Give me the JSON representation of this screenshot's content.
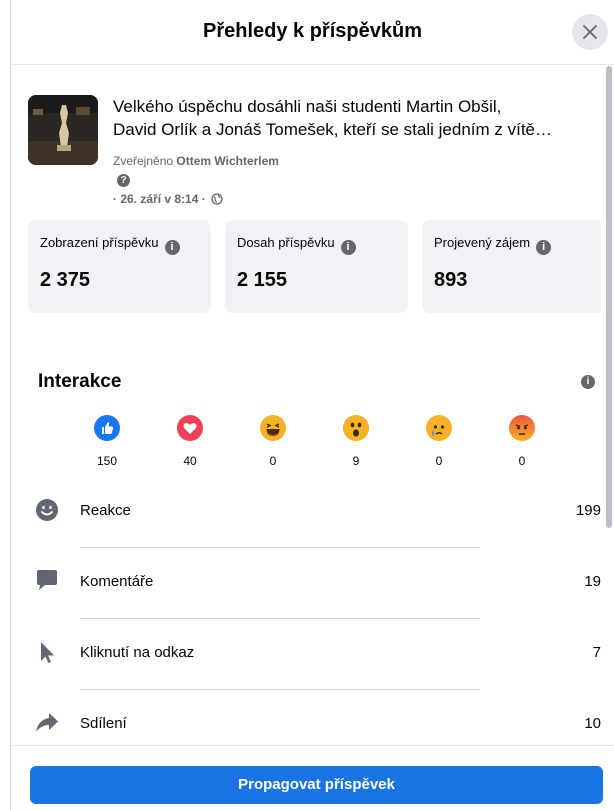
{
  "dialog": {
    "title": "Přehledy k příspěvkům",
    "close_icon": "close-icon"
  },
  "post": {
    "text": "Velkého úspěchu dosáhli naši studenti Martin Obšil,\nDavid Orlík a Jonáš Tomešek, kteří se stali jedním z vítě…",
    "published_prefix": "Zveřejněno",
    "author": "Ottem Wichterlem",
    "date": "· 26. září v 8:14 ·",
    "privacy_icon": "globe-icon"
  },
  "metrics": [
    {
      "label": "Zobrazení příspěvku",
      "value": "2 375"
    },
    {
      "label": "Dosah příspěvku",
      "value": "2 155"
    },
    {
      "label": "Projevený zájem",
      "value": "893"
    }
  ],
  "interactions": {
    "title": "Interakce",
    "reactions": [
      {
        "icon": "like-icon",
        "count": "150",
        "color": "#1877f2"
      },
      {
        "icon": "love-icon",
        "count": "40",
        "color": "#f33e58"
      },
      {
        "icon": "haha-icon",
        "count": "0",
        "color": "#f7b125"
      },
      {
        "icon": "wow-icon",
        "count": "9",
        "color": "#f7b125"
      },
      {
        "icon": "sad-icon",
        "count": "0",
        "color": "#f7b125"
      },
      {
        "icon": "angry-icon",
        "count": "0",
        "color": "#e9710f"
      }
    ],
    "rows": [
      {
        "icon": "smiley-icon",
        "label": "Reakce",
        "value": "199"
      },
      {
        "icon": "comment-icon",
        "label": "Komentáře",
        "value": "19"
      },
      {
        "icon": "cursor-icon",
        "label": "Kliknutí na odkaz",
        "value": "7"
      },
      {
        "icon": "share-icon",
        "label": "Sdílení",
        "value": "10"
      }
    ]
  },
  "footer": {
    "promote_label": "Propagovat příspěvek"
  },
  "colors": {
    "accent": "#1b74e4",
    "card_bg": "#f0f2f5",
    "secondary_text": "#65676b"
  }
}
